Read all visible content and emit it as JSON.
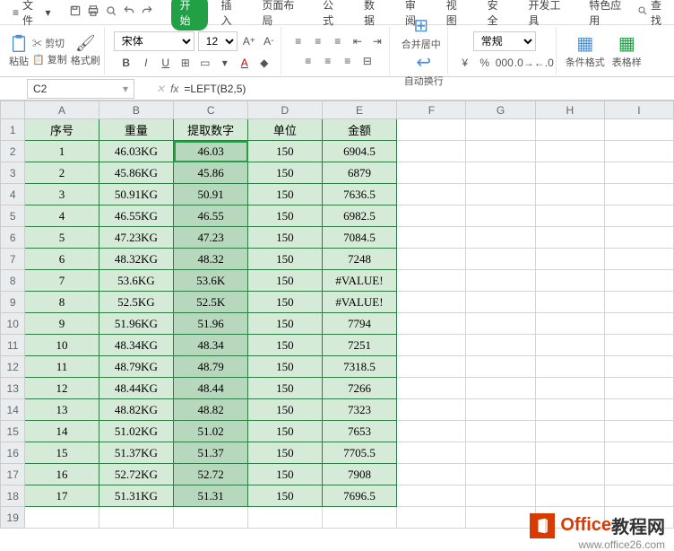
{
  "menubar": {
    "file": "文件",
    "tabs": [
      "开始",
      "插入",
      "页面布局",
      "公式",
      "数据",
      "审阅",
      "视图",
      "安全",
      "开发工具",
      "特色应用"
    ],
    "activeTab": 0,
    "find": "查找"
  },
  "ribbon": {
    "paste": "粘贴",
    "cut": "剪切",
    "copy": "复制",
    "formatPainter": "格式刷",
    "fontName": "宋体",
    "fontSize": "12",
    "merge": "合并居中",
    "wrap": "自动换行",
    "numFmt": "常规",
    "condFmt": "条件格式",
    "tableStyle": "表格样"
  },
  "formulaBar": {
    "name": "C2",
    "formula": "=LEFT(B2,5)"
  },
  "columns": [
    "A",
    "B",
    "C",
    "D",
    "E",
    "F",
    "G",
    "H",
    "I"
  ],
  "headers": {
    "A": "序号",
    "B": "重量",
    "C": "提取数字",
    "D": "单位",
    "E": "金额"
  },
  "rows": [
    {
      "n": "1",
      "A": "1",
      "B": "46.03KG",
      "C": "46.03",
      "D": "150",
      "E": "6904.5"
    },
    {
      "n": "2",
      "A": "2",
      "B": "45.86KG",
      "C": "45.86",
      "D": "150",
      "E": "6879"
    },
    {
      "n": "3",
      "A": "3",
      "B": "50.91KG",
      "C": "50.91",
      "D": "150",
      "E": "7636.5"
    },
    {
      "n": "4",
      "A": "4",
      "B": "46.55KG",
      "C": "46.55",
      "D": "150",
      "E": "6982.5"
    },
    {
      "n": "5",
      "A": "5",
      "B": "47.23KG",
      "C": "47.23",
      "D": "150",
      "E": "7084.5"
    },
    {
      "n": "6",
      "A": "6",
      "B": "48.32KG",
      "C": "48.32",
      "D": "150",
      "E": "7248"
    },
    {
      "n": "7",
      "A": "7",
      "B": "53.6KG",
      "C": "53.6K",
      "D": "150",
      "E": "#VALUE!"
    },
    {
      "n": "8",
      "A": "8",
      "B": "52.5KG",
      "C": "52.5K",
      "D": "150",
      "E": "#VALUE!"
    },
    {
      "n": "9",
      "A": "9",
      "B": "51.96KG",
      "C": "51.96",
      "D": "150",
      "E": "7794"
    },
    {
      "n": "10",
      "A": "10",
      "B": "48.34KG",
      "C": "48.34",
      "D": "150",
      "E": "7251"
    },
    {
      "n": "11",
      "A": "11",
      "B": "48.79KG",
      "C": "48.79",
      "D": "150",
      "E": "7318.5"
    },
    {
      "n": "12",
      "A": "12",
      "B": "48.44KG",
      "C": "48.44",
      "D": "150",
      "E": "7266"
    },
    {
      "n": "13",
      "A": "13",
      "B": "48.82KG",
      "C": "48.82",
      "D": "150",
      "E": "7323"
    },
    {
      "n": "14",
      "A": "14",
      "B": "51.02KG",
      "C": "51.02",
      "D": "150",
      "E": "7653"
    },
    {
      "n": "15",
      "A": "15",
      "B": "51.37KG",
      "C": "51.37",
      "D": "150",
      "E": "7705.5"
    },
    {
      "n": "16",
      "A": "16",
      "B": "52.72KG",
      "C": "52.72",
      "D": "150",
      "E": "7908"
    },
    {
      "n": "17",
      "A": "17",
      "B": "51.31KG",
      "C": "51.31",
      "D": "150",
      "E": "7696.5"
    }
  ],
  "watermark": {
    "brand1": "Office",
    "brand2": "教程网",
    "url": "www.office26.com"
  }
}
